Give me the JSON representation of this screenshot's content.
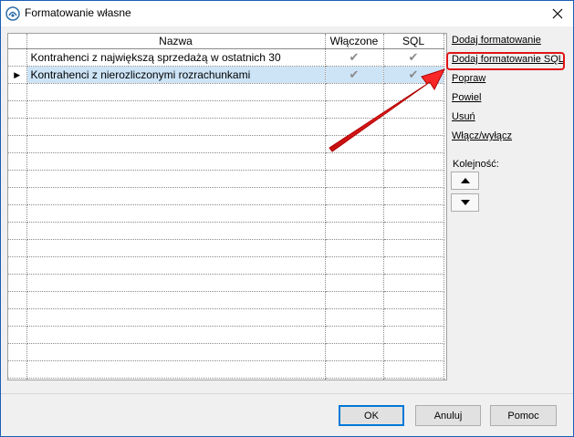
{
  "window": {
    "title": "Formatowanie własne"
  },
  "grid": {
    "columns": [
      "Nazwa",
      "Włączone",
      "SQL"
    ],
    "rows": [
      {
        "name": "Kontrahenci z największą sprzedażą w ostatnich 30",
        "enabled": "✔",
        "sql": "✔",
        "selected": false
      },
      {
        "name": "Kontrahenci z nierozliczonymi rozrachunkami",
        "enabled": "✔",
        "sql": "✔",
        "selected": true
      }
    ]
  },
  "actions": {
    "add": "Dodaj formatowanie",
    "add_sql": "Dodaj formatowanie SQL",
    "edit": "Popraw",
    "duplicate": "Powiel",
    "delete": "Usuń",
    "toggle": "Włącz/wyłącz",
    "order_label": "Kolejność:"
  },
  "buttons": {
    "ok": "OK",
    "cancel": "Anuluj",
    "help": "Pomoc"
  },
  "colors": {
    "highlight": "#e01414",
    "selection": "#cde4f7"
  }
}
